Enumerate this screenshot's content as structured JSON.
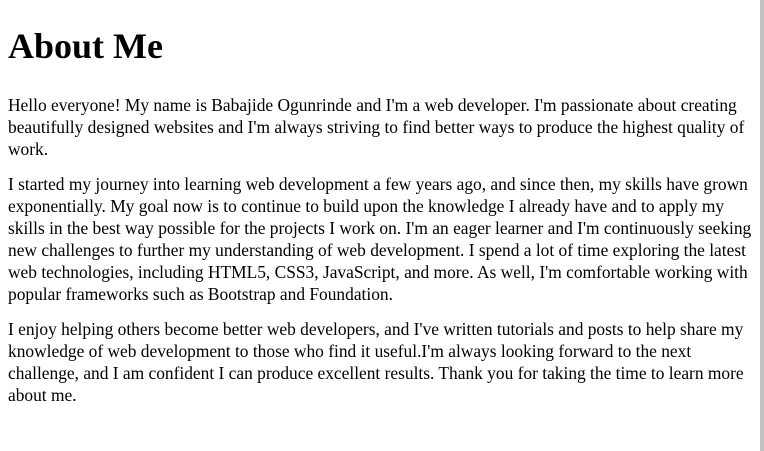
{
  "page": {
    "heading": "About Me",
    "paragraphs": [
      "Hello everyone! My name is Babajide Ogunrinde and I'm a web developer. I'm passionate about creating beautifully designed websites and I'm always striving to find better ways to produce the highest quality of work.",
      "I started my journey into learning web development a few years ago, and since then, my skills have grown exponentially. My goal now is to continue to build upon the knowledge I already have and to apply my skills in the best way possible for the projects I work on. I'm an eager learner and I'm continuously seeking new challenges to further my understanding of web development. I spend a lot of time exploring the latest web technologies, including HTML5, CSS3, JavaScript, and more. As well, I'm comfortable working with popular frameworks such as Bootstrap and Foundation.",
      "I enjoy helping others become better web developers, and I've written tutorials and posts to help share my knowledge of web development to those who find it useful.I'm always looking forward to the next challenge, and I am confident I can produce excellent results. Thank you for taking the time to learn more about me."
    ]
  }
}
